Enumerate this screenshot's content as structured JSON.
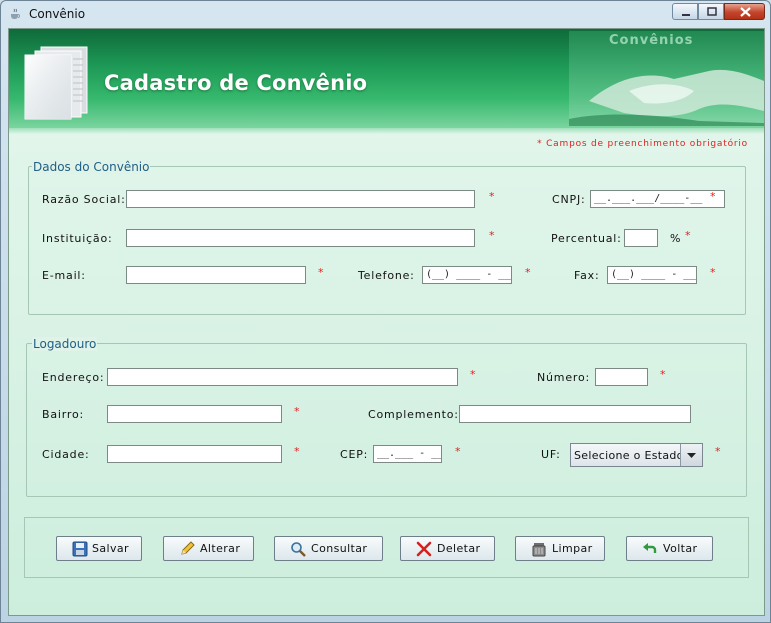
{
  "window": {
    "title": "Convênio"
  },
  "banner": {
    "title": "Cadastro de Convênio",
    "photo_caption": "Convênios"
  },
  "required_note": "* Campos de preenchimento obrigatório",
  "required_marker": "*",
  "colors": {
    "banner_green": "#1f9c58",
    "required_red": "#e02020",
    "legend_blue": "#1f5f86",
    "panel_bg": "#dff3e8"
  },
  "dados": {
    "legend": "Dados do Convênio",
    "razao_label": "Razão Social:",
    "razao_value": "",
    "cnpj_label": "CNPJ:",
    "cnpj_value": "__.___.___/____-__",
    "instituicao_label": "Instituição:",
    "instituicao_value": "",
    "percentual_label": "Percentual:",
    "percentual_value": "",
    "percentual_unit": "%",
    "email_label": "E-mail:",
    "email_value": "",
    "telefone_label": "Telefone:",
    "telefone_value": "(__) ____ - ____",
    "fax_label": "Fax:",
    "fax_value": "(__) ____ - ____"
  },
  "logradouro": {
    "legend": "Logadouro",
    "endereco_label": "Endereço:",
    "endereco_value": "",
    "numero_label": "Número:",
    "numero_value": "",
    "bairro_label": "Bairro:",
    "bairro_value": "",
    "complemento_label": "Complemento:",
    "complemento_value": "",
    "cidade_label": "Cidade:",
    "cidade_value": "",
    "cep_label": "CEP:",
    "cep_value": "__.___ - ___",
    "uf_label": "UF:",
    "uf_selected": "Selecione o Estado"
  },
  "buttons": [
    {
      "label": "Salvar",
      "icon": "save-icon"
    },
    {
      "label": "Alterar",
      "icon": "pencil-icon"
    },
    {
      "label": "Consultar",
      "icon": "search-icon"
    },
    {
      "label": "Deletar",
      "icon": "delete-icon"
    },
    {
      "label": "Limpar",
      "icon": "trash-icon"
    },
    {
      "label": "Voltar",
      "icon": "back-arrow-icon"
    }
  ]
}
